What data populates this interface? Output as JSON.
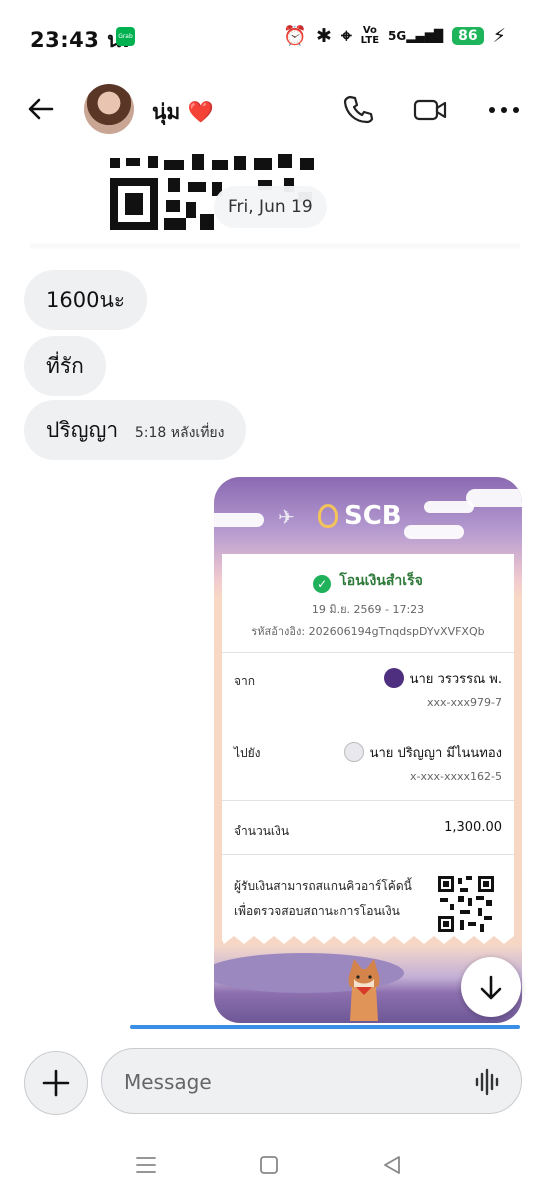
{
  "status_bar": {
    "time": "23:43 น.",
    "network_label_1": "Vo",
    "network_label_2": "LTE",
    "signal_label": "5G",
    "battery": "86"
  },
  "header": {
    "contact_name": "นุ่ม",
    "contact_emoji": "❤️",
    "call_icon": "phone-icon",
    "video_icon": "video-camera-icon",
    "more_icon": "more-dots-icon"
  },
  "chat": {
    "date_separator": "Fri, Jun 19",
    "messages": [
      {
        "text": "1600นะ",
        "timestamp": ""
      },
      {
        "text": "ที่รัก",
        "timestamp": ""
      },
      {
        "text": "ปริญญา",
        "timestamp": "5:18 หลังเที่ยง"
      }
    ]
  },
  "receipt": {
    "bank": "SCB",
    "status": "โอนเงินสำเร็จ",
    "datetime": "19 มิ.ย. 2569 - 17:23",
    "ref_label": "รหัสอ้างอิง:",
    "ref_value": "202606194gTnqdspDYvXVFXQb",
    "from_label": "จาก",
    "from_name": "นาย วรวรรณ พ.",
    "from_account": "xxx-xxx979-7",
    "to_label": "ไปยัง",
    "to_name": "นาย ปริญญา มีไนนทอง",
    "to_account": "x-xxx-xxxx162-5",
    "amount_label": "จำนวนเงิน",
    "amount_value": "1,300.00",
    "note_line1": "ผู้รับเงินสามารถสแกนคิวอาร์โค้ดนี้",
    "note_line2": "เพื่อตรวจสอบสถานะการโอนเงิน"
  },
  "composer": {
    "placeholder": "Message"
  },
  "colors": {
    "bubble_bg": "#eef0f2",
    "accent_blue": "#3a8ee6",
    "success_green": "#1fb25a",
    "scb_purple": "#4e2e7f"
  }
}
